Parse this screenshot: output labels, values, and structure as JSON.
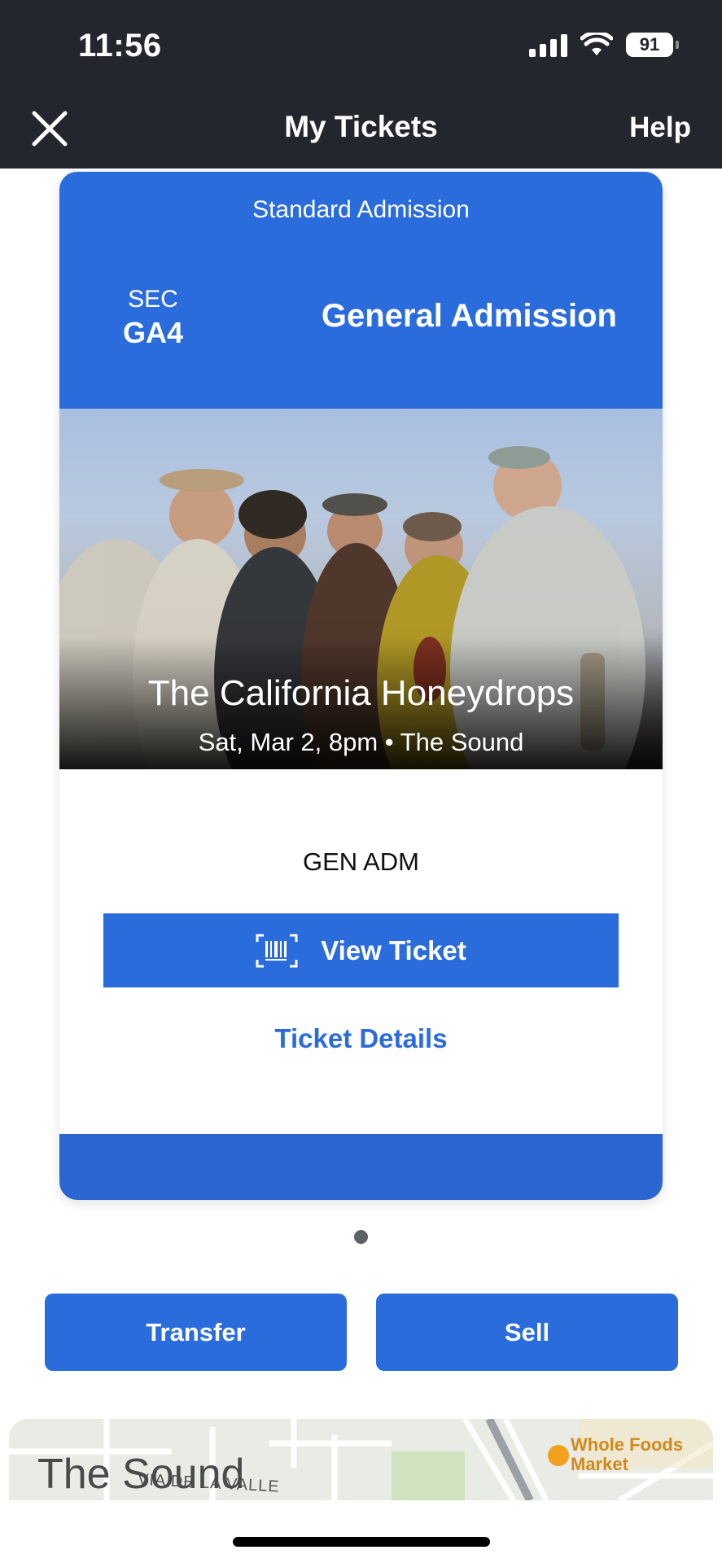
{
  "status_bar": {
    "time": "11:56",
    "battery": "91"
  },
  "nav": {
    "title": "My Tickets",
    "help": "Help"
  },
  "ticket": {
    "admission_type": "Standard Admission",
    "section_label": "SEC",
    "section_value": "GA4",
    "section_name": "General Admission",
    "event_name": "The California Honeydrops",
    "event_meta": "Sat, Mar 2, 8pm • The Sound",
    "entry_label": "GEN ADM",
    "view_ticket_label": "View Ticket",
    "details_label": "Ticket Details"
  },
  "actions": {
    "transfer": "Transfer",
    "sell": "Sell"
  },
  "map": {
    "venue": "The Sound",
    "street": "VIA DE LA VALLE",
    "poi": "Whole Foods Market"
  },
  "colors": {
    "brand_blue": "#2b6cdc",
    "header_dark": "#23262d"
  },
  "icons": [
    "close-icon",
    "barcode-icon",
    "signal-icon",
    "wifi-icon",
    "battery-icon"
  ]
}
